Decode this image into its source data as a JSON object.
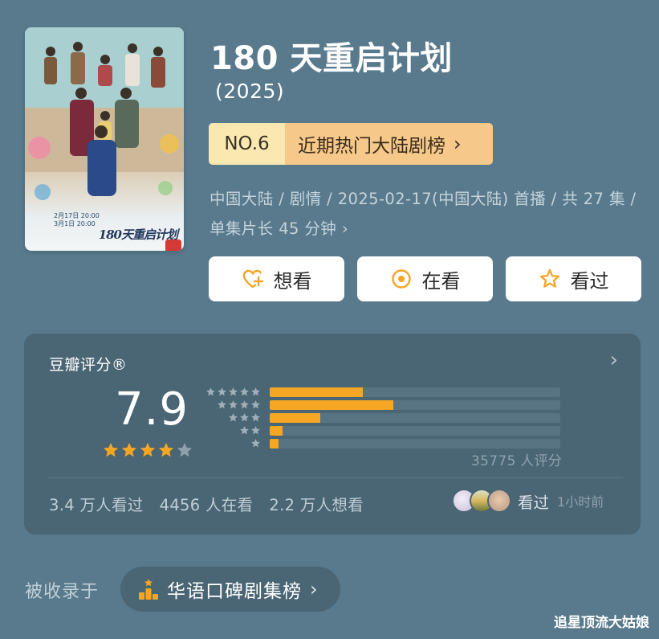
{
  "show": {
    "title": "180 天重启计划",
    "year": "(2025)",
    "poster": {
      "date_line_1": "2月17日 20:00",
      "date_line_2": "3月1日 20:00",
      "title_art": "180天重启计划"
    }
  },
  "rank": {
    "number": "NO.6",
    "name": "近期热门大陆剧榜",
    "chevron": "›"
  },
  "meta": {
    "text": "中国大陆 / 剧情 / 2025-02-17(中国大陆) 首播 / 共 27 集 / 单集片长 45 分钟",
    "chevron": "›"
  },
  "actions": [
    {
      "label": "想看",
      "icon": "heart-plus-icon"
    },
    {
      "label": "在看",
      "icon": "target-circle-icon"
    },
    {
      "label": "看过",
      "icon": "star-outline-icon"
    }
  ],
  "rating": {
    "title": "豆瓣评分®",
    "chevron": "›",
    "score": "7.9",
    "stars_filled": 4,
    "stars_total": 5,
    "distribution": [
      {
        "stars": 5,
        "fraction": 0.32
      },
      {
        "stars": 4,
        "fraction": 0.425
      },
      {
        "stars": 3,
        "fraction": 0.175
      },
      {
        "stars": 2,
        "fraction": 0.045
      },
      {
        "stars": 1,
        "fraction": 0.03
      }
    ],
    "count_label": "35775 人评分",
    "stats": [
      "3.4 万人看过",
      "4456 人在看",
      "2.2 万人想看"
    ],
    "friends_label": "看过",
    "friends_time": "1小时前"
  },
  "included": {
    "label": "被收录于",
    "chart_name": "华语口碑剧集榜",
    "chevron": "›"
  },
  "watermark": "追星顶流大姑娘",
  "colors": {
    "background": "#587a8c",
    "card": "#4a6574",
    "star": "#f5a623",
    "rank_left": "#fbe8b0",
    "rank_right": "#f6c98a"
  }
}
